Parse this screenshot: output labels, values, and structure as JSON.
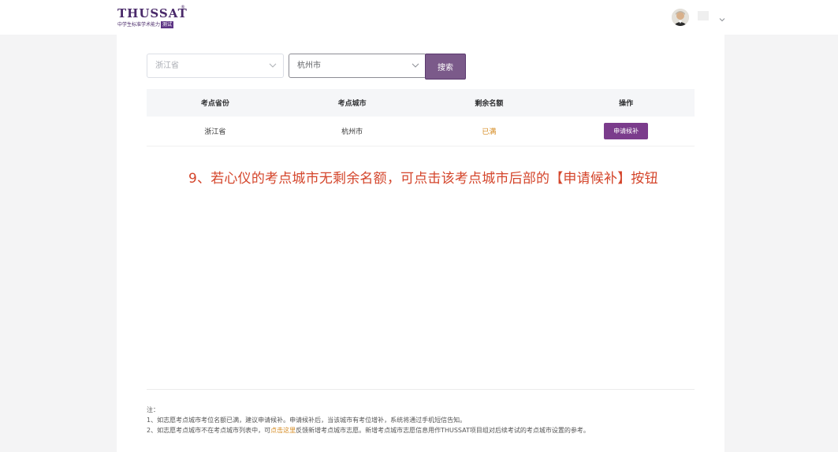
{
  "header": {
    "logo_title": "THUSSAT",
    "logo_reg": "®",
    "logo_subtitle": "中学生标准学术能力",
    "logo_badge": "测试",
    "user_menu_icon": "chevron-down-icon",
    "avatar_icon": "user-avatar"
  },
  "filters": {
    "province_value": "浙江省",
    "city_value": "杭州市",
    "search_label": "搜索"
  },
  "table": {
    "headers": [
      "考点省份",
      "考点城市",
      "剩余名额",
      "操作"
    ],
    "rows": [
      {
        "province": "浙江省",
        "city": "杭州市",
        "remaining": "已满",
        "action": "申请候补"
      }
    ]
  },
  "annotation": "9、若心仪的考点城市无剩余名额，可点击该考点城市后部的【申请候补】按钮",
  "notes": {
    "heading": "注：",
    "line1": "1、如志愿考点城市考位名额已满，建议申请候补。申请候补后，当该城市有考位增补，系统将通过手机短信告知。",
    "line2_prefix": "2、如志愿考点城市不在考点城市列表中，可",
    "line2_link": "点击这里",
    "line2_suffix": "反馈新增考点城市志愿。新增考点城市志愿信息用作THUSSAT项目组对后续考试的考点城市设置的参考。"
  },
  "colors": {
    "brand": "#4a2a6a",
    "button": "#7b5a8a",
    "apply_button": "#7b3c8c",
    "full_status": "#d58a1f",
    "annotation": "#d4452b"
  }
}
